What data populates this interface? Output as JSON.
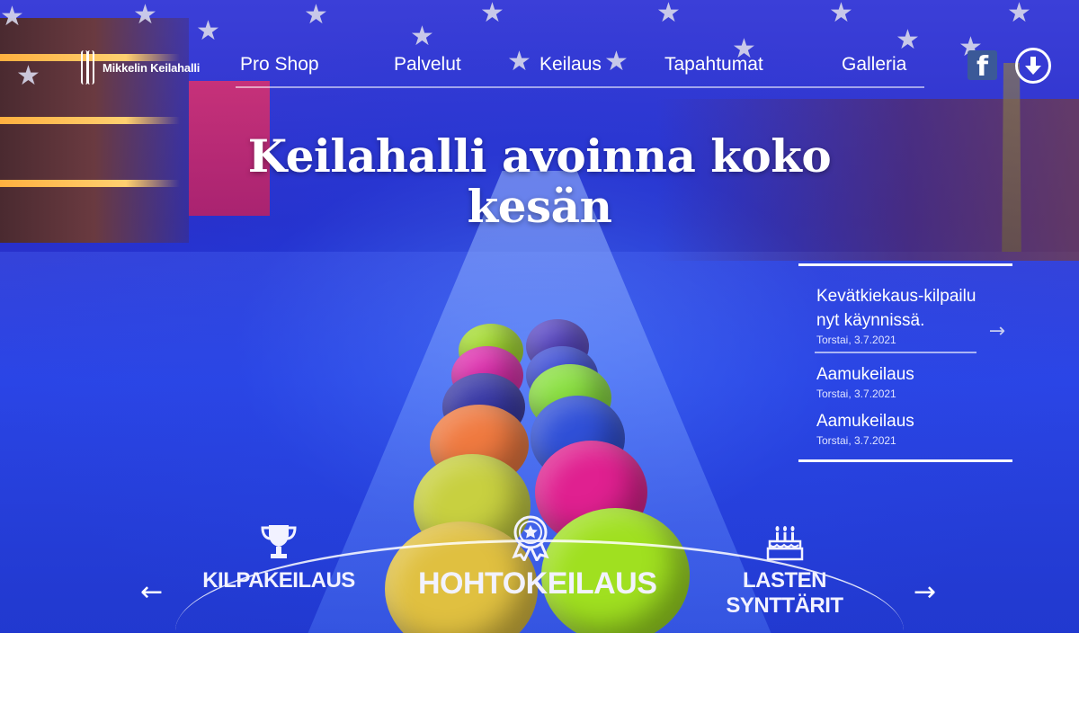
{
  "nav": {
    "logo_text": "Mikkelin Keilahalli",
    "items": [
      {
        "label": "Pro Shop"
      },
      {
        "label": "Palvelut"
      },
      {
        "label": "Keilaus"
      },
      {
        "label": "Tapahtumat"
      },
      {
        "label": "Galleria"
      }
    ],
    "social": {
      "facebook_icon": "facebook-icon",
      "download_icon": "download-icon"
    }
  },
  "hero": {
    "headline": "Keilahalli avoinna koko kesän"
  },
  "news": [
    {
      "title": "Kevätkiekaus-kilpailu nyt käynnissä.",
      "date": "Torstai, 3.7.2021"
    },
    {
      "title": "Aamukeilaus",
      "date": "Torstai, 3.7.2021"
    },
    {
      "title": "Aamukeilaus",
      "date": "Torstai, 3.7.2021"
    }
  ],
  "categories": [
    {
      "label": "KILPAKEILAUS",
      "icon": "trophy-icon"
    },
    {
      "label": "HOHTOKEILAUS",
      "icon": "award-ribbon-icon"
    },
    {
      "label": "LASTEN SYNTTÄRIT",
      "icon": "birthday-cake-icon"
    }
  ],
  "carousel": {
    "prev": "←",
    "next": "→"
  },
  "news_arrow": "→",
  "colors": {
    "facebook": "#3b5998",
    "background": "#2a2fc8"
  }
}
